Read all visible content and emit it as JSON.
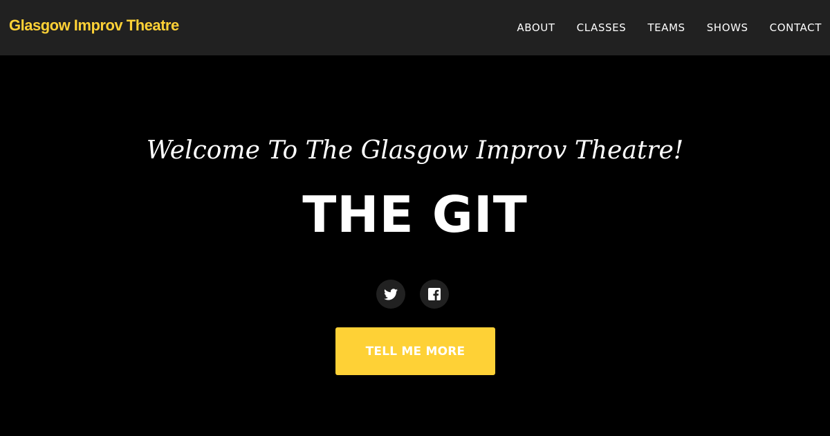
{
  "navbar": {
    "brand": "Glasgow Improv Theatre",
    "links": [
      "ABOUT",
      "CLASSES",
      "TEAMS",
      "SHOWS",
      "CONTACT"
    ]
  },
  "hero": {
    "lead_in": "Welcome To The Glasgow Improv Theatre!",
    "heading": "THE GIT",
    "social_icons": [
      "twitter-icon",
      "facebook-icon"
    ],
    "cta_label": "TELL ME MORE"
  },
  "colors": {
    "brand_accent": "#fed136",
    "navbar_bg": "#212121",
    "hero_bg": "#000000",
    "text": "#ffffff"
  }
}
